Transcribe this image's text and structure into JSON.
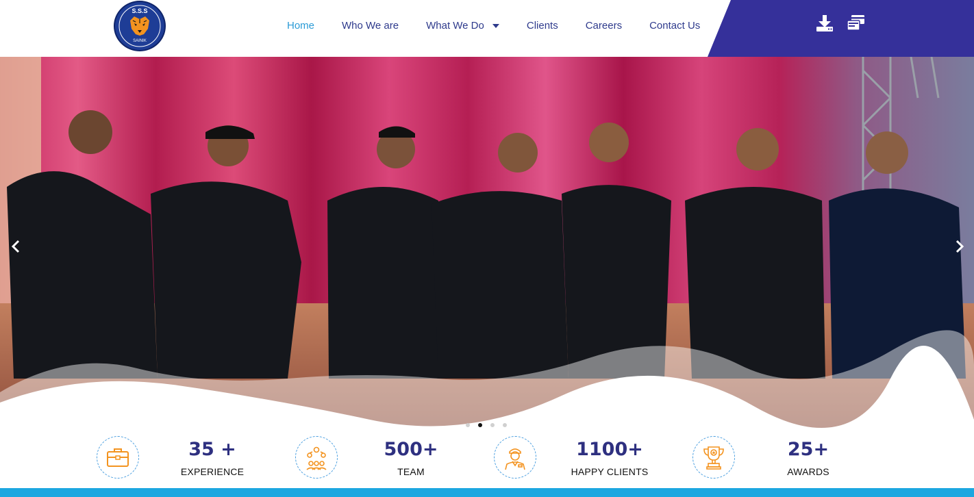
{
  "brand": {
    "logo_text": "S.S.S",
    "logo_subtext": "SAINIK"
  },
  "nav": {
    "items": [
      {
        "label": "Home",
        "active": true
      },
      {
        "label": "Who We are",
        "active": false
      },
      {
        "label": "What We Do",
        "active": false,
        "has_dropdown": true
      },
      {
        "label": "Clients",
        "active": false
      },
      {
        "label": "Careers",
        "active": false
      },
      {
        "label": "Contact Us",
        "active": false
      }
    ],
    "active_color": "#2b9bd6",
    "text_color": "#2e3a8c"
  },
  "header_actions": {
    "panel_color": "#35309a",
    "icons": [
      "download-icon",
      "payment-icon"
    ]
  },
  "hero": {
    "slider": {
      "slide_count": 4,
      "active_slide": 2,
      "prev_icon": "chevron-left-icon",
      "next_icon": "chevron-right-icon"
    }
  },
  "stats": [
    {
      "number": "35 +",
      "label": "EXPERIENCE",
      "icon": "briefcase-icon"
    },
    {
      "number": "500+",
      "label": "TEAM",
      "icon": "team-icon"
    },
    {
      "number": "1100+",
      "label": "HAPPY CLIENTS",
      "icon": "client-icon"
    },
    {
      "number": "25+",
      "label": "AWARDS",
      "icon": "trophy-icon"
    }
  ],
  "colors": {
    "accent_orange": "#f3931f",
    "stat_number": "#2e3080",
    "bottom_bar": "#1da7e0"
  }
}
